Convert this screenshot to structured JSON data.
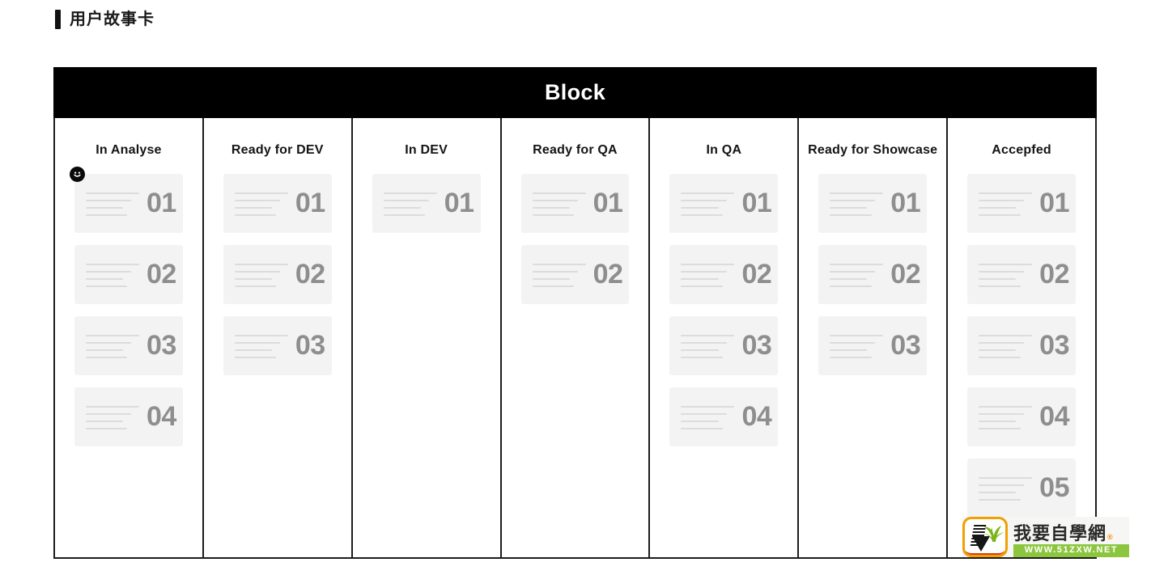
{
  "page": {
    "title": "用户故事卡"
  },
  "board": {
    "header_title": "Block",
    "columns": [
      {
        "title": "In Analyse",
        "cards": [
          "01",
          "02",
          "03",
          "04"
        ]
      },
      {
        "title": "Ready for DEV",
        "cards": [
          "01",
          "02",
          "03"
        ]
      },
      {
        "title": "In DEV",
        "cards": [
          "01"
        ]
      },
      {
        "title": "Ready for QA",
        "cards": [
          "01",
          "02"
        ]
      },
      {
        "title": "In QA",
        "cards": [
          "01",
          "02",
          "03",
          "04"
        ]
      },
      {
        "title": "Ready for Showcase",
        "cards": [
          "01",
          "02",
          "03"
        ]
      },
      {
        "title": "Accepfed",
        "cards": [
          "01",
          "02",
          "03",
          "04",
          "05"
        ]
      }
    ]
  },
  "cursor": {
    "icon": "smiley-face-cursor"
  },
  "watermark": {
    "brand_cn": "我要自學網",
    "registered_mark": "®",
    "url": "WWW.51ZXW.NET",
    "badge_icon": "plant-in-pot-logo"
  },
  "colors": {
    "header_bg": "#000000",
    "header_text": "#ffffff",
    "border": "#1c1c1c",
    "card_bg": "#f3f3f3",
    "card_number": "#8e8e8e",
    "card_line": "#dcdcdc",
    "watermark_green": "#8cc63e",
    "watermark_orange": "#f0a000"
  }
}
